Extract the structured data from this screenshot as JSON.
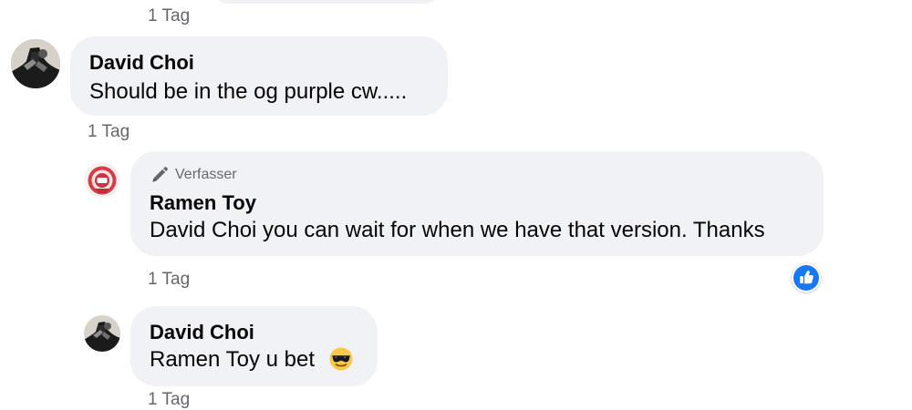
{
  "thread": {
    "timestamp_label": "1 Tag",
    "comments": [
      {
        "author": "David Choi",
        "text": "Should be in the og purple cw....."
      },
      {
        "badge": "Verfasser",
        "author": "Ramen Toy",
        "text": "David Choi you can wait for when we have that version. Thanks"
      },
      {
        "author": "David Choi",
        "text": "Ramen Toy u bet"
      }
    ]
  },
  "icons": {
    "author_badge": "pencil-icon",
    "reaction": "like-icon",
    "emoji": "sunglasses-emoji"
  },
  "colors": {
    "bubble": "#f0f2f5",
    "meta_text": "#65676b",
    "accent": "#1877f2"
  }
}
